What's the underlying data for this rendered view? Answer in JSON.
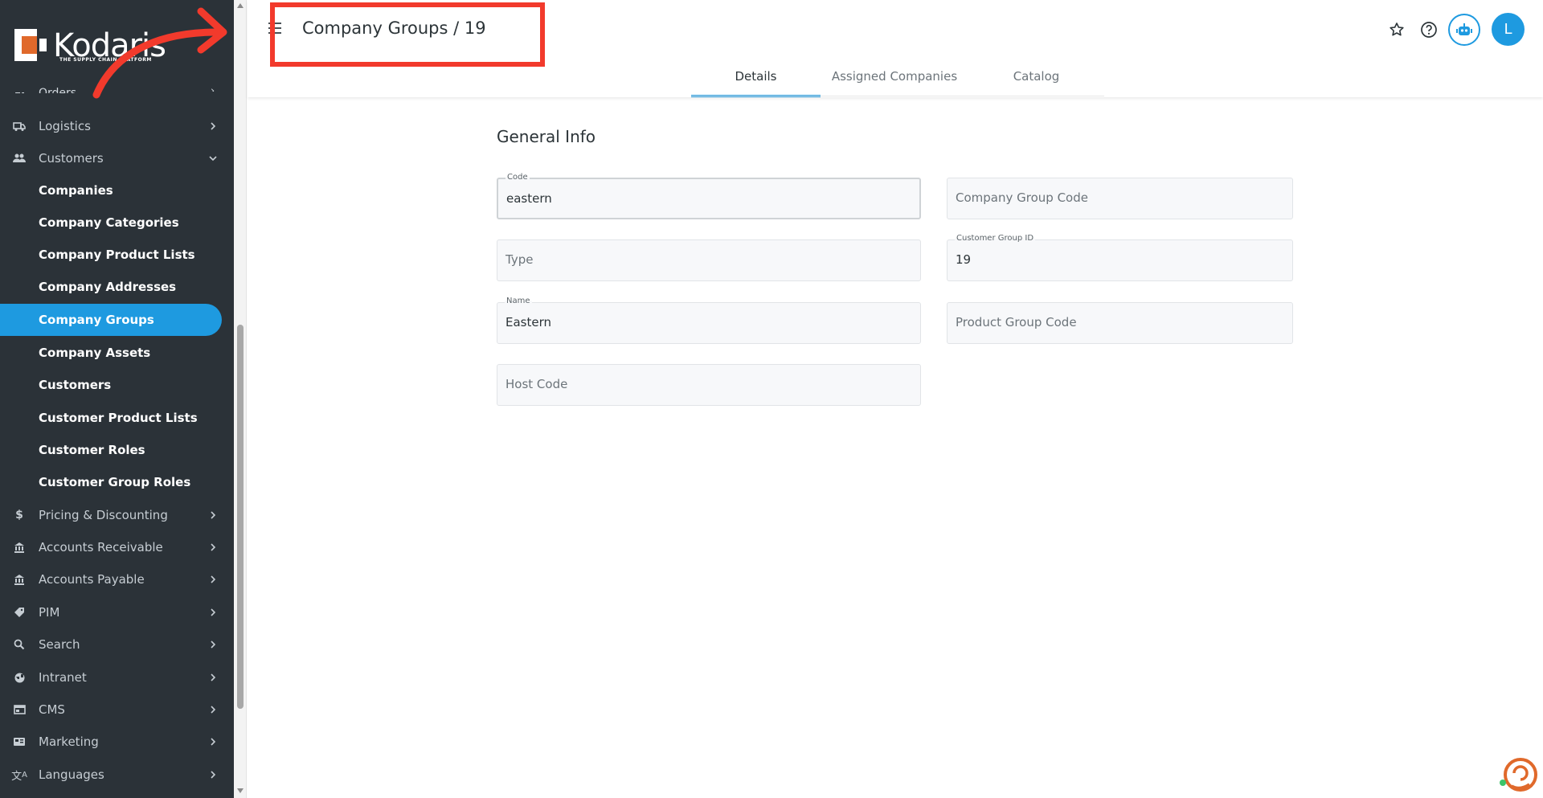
{
  "brand": {
    "name": "Kodaris",
    "tagline": "THE SUPPLY CHAIN PLATFORM",
    "logo_color": "#e0692b"
  },
  "sidebar": {
    "partial_item": "Orders",
    "items": [
      {
        "label": "Logistics",
        "icon": "truck-icon",
        "expanded": false
      },
      {
        "label": "Customers",
        "icon": "people-icon",
        "expanded": true
      }
    ],
    "customers_children": [
      "Companies",
      "Company Categories",
      "Company Product Lists",
      "Company Addresses",
      "Company Groups",
      "Company Assets",
      "Customers",
      "Customer Product Lists",
      "Customer Roles",
      "Customer Group Roles"
    ],
    "active_child": "Company Groups",
    "more_items": [
      {
        "label": "Pricing & Discounting",
        "icon": "dollar-icon"
      },
      {
        "label": "Accounts Receivable",
        "icon": "bank-icon"
      },
      {
        "label": "Accounts Payable",
        "icon": "bank-icon"
      },
      {
        "label": "PIM",
        "icon": "tag-icon"
      },
      {
        "label": "Search",
        "icon": "search-icon"
      },
      {
        "label": "Intranet",
        "icon": "globe-icon"
      },
      {
        "label": "CMS",
        "icon": "web-icon"
      },
      {
        "label": "Marketing",
        "icon": "campaign-icon"
      },
      {
        "label": "Languages",
        "icon": "translate-icon"
      }
    ],
    "bg_color": "#2b3238",
    "active_color": "#1e9ae0"
  },
  "header": {
    "title": "Company Groups / 19",
    "tabs": [
      "Details",
      "Assigned Companies",
      "Catalog"
    ],
    "active_tab": "Details",
    "avatar_initial": "L",
    "icons": [
      "star-icon",
      "help-icon",
      "bot-icon"
    ],
    "highlight_color": "#f23a2c"
  },
  "form": {
    "section_title": "General Info",
    "code": {
      "label": "Code",
      "value": "eastern"
    },
    "company_group_code": {
      "placeholder": "Company Group Code"
    },
    "type": {
      "placeholder": "Type"
    },
    "customer_group_id": {
      "label": "Customer Group ID",
      "value": "19"
    },
    "name": {
      "label": "Name",
      "value": "Eastern"
    },
    "product_group_code": {
      "placeholder": "Product Group Code"
    },
    "host_code": {
      "placeholder": "Host Code"
    }
  }
}
